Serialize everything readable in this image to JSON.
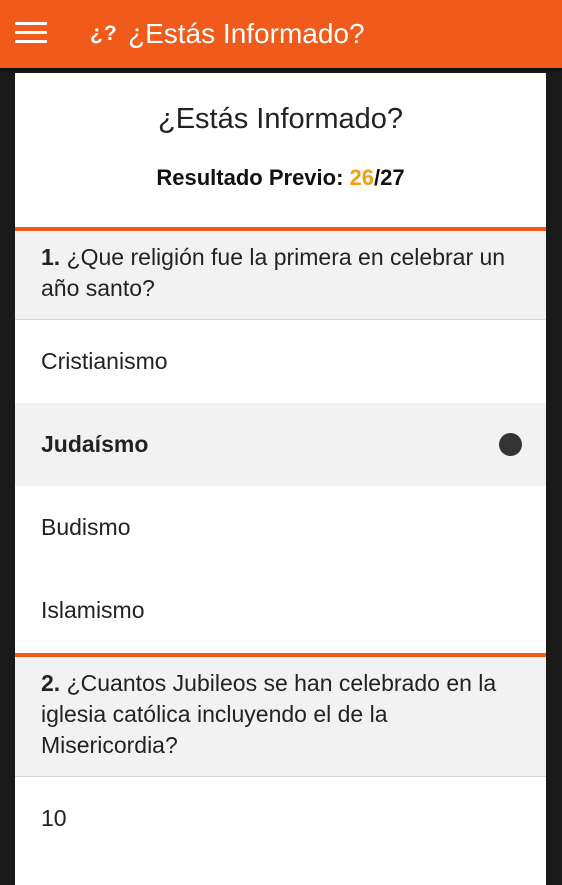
{
  "appbar": {
    "logo": "¿?",
    "title": "¿Estás Informado?"
  },
  "quiz": {
    "title": "¿Estás Informado?",
    "previous_label": "Resultado Previo:",
    "previous_score": "26",
    "previous_total": "/27"
  },
  "questions": [
    {
      "number": "1.",
      "text": "¿Que religión fue la primera en celebrar un año santo?",
      "options": [
        "Cristianismo",
        "Judaísmo",
        "Budismo",
        "Islamismo"
      ],
      "selected": "Judaísmo"
    },
    {
      "number": "2.",
      "text": "¿Cuantos Jubileos se han celebrado en la iglesia católica incluyendo el de la Misericordia?",
      "options": [
        "10"
      ]
    }
  ],
  "colors": {
    "appbar": "#f05a1a",
    "accent_score": "#f0a012",
    "question_bg": "#f2f2f2"
  },
  "icons": {
    "menu": "hamburger-menu-icon",
    "selected_option": "radio-selected-icon"
  }
}
